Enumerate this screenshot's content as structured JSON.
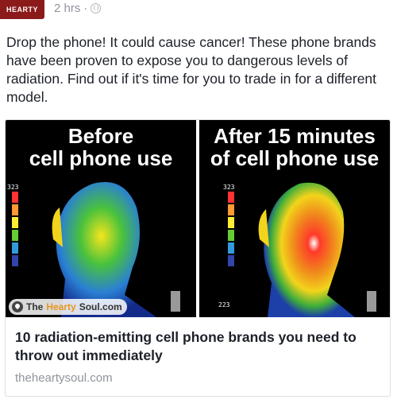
{
  "post": {
    "avatar_text": "HEARTY",
    "timestamp": "2 hrs",
    "separator": "·",
    "body": "Drop the phone! It could cause cancer! These phone brands have been proven to expose you to dangerous levels of radiation. Find out if it's time for you to trade in for a different model."
  },
  "card": {
    "left_title": "Before\ncell phone use",
    "right_title": "After 15 minutes\nof cell phone use",
    "watermark_pre": "The",
    "watermark_hearty": "Hearty",
    "watermark_post": "Soul.com",
    "scale_left_top": "323",
    "scale_right_top": "323",
    "scale_right_bottom": "223",
    "title": "10 radiation-emitting cell phone brands you need to throw out immediately",
    "domain": "theheartysoul.com"
  },
  "colors": {
    "meta": "#90949c",
    "text": "#1d2129",
    "border": "#dddfe2"
  }
}
